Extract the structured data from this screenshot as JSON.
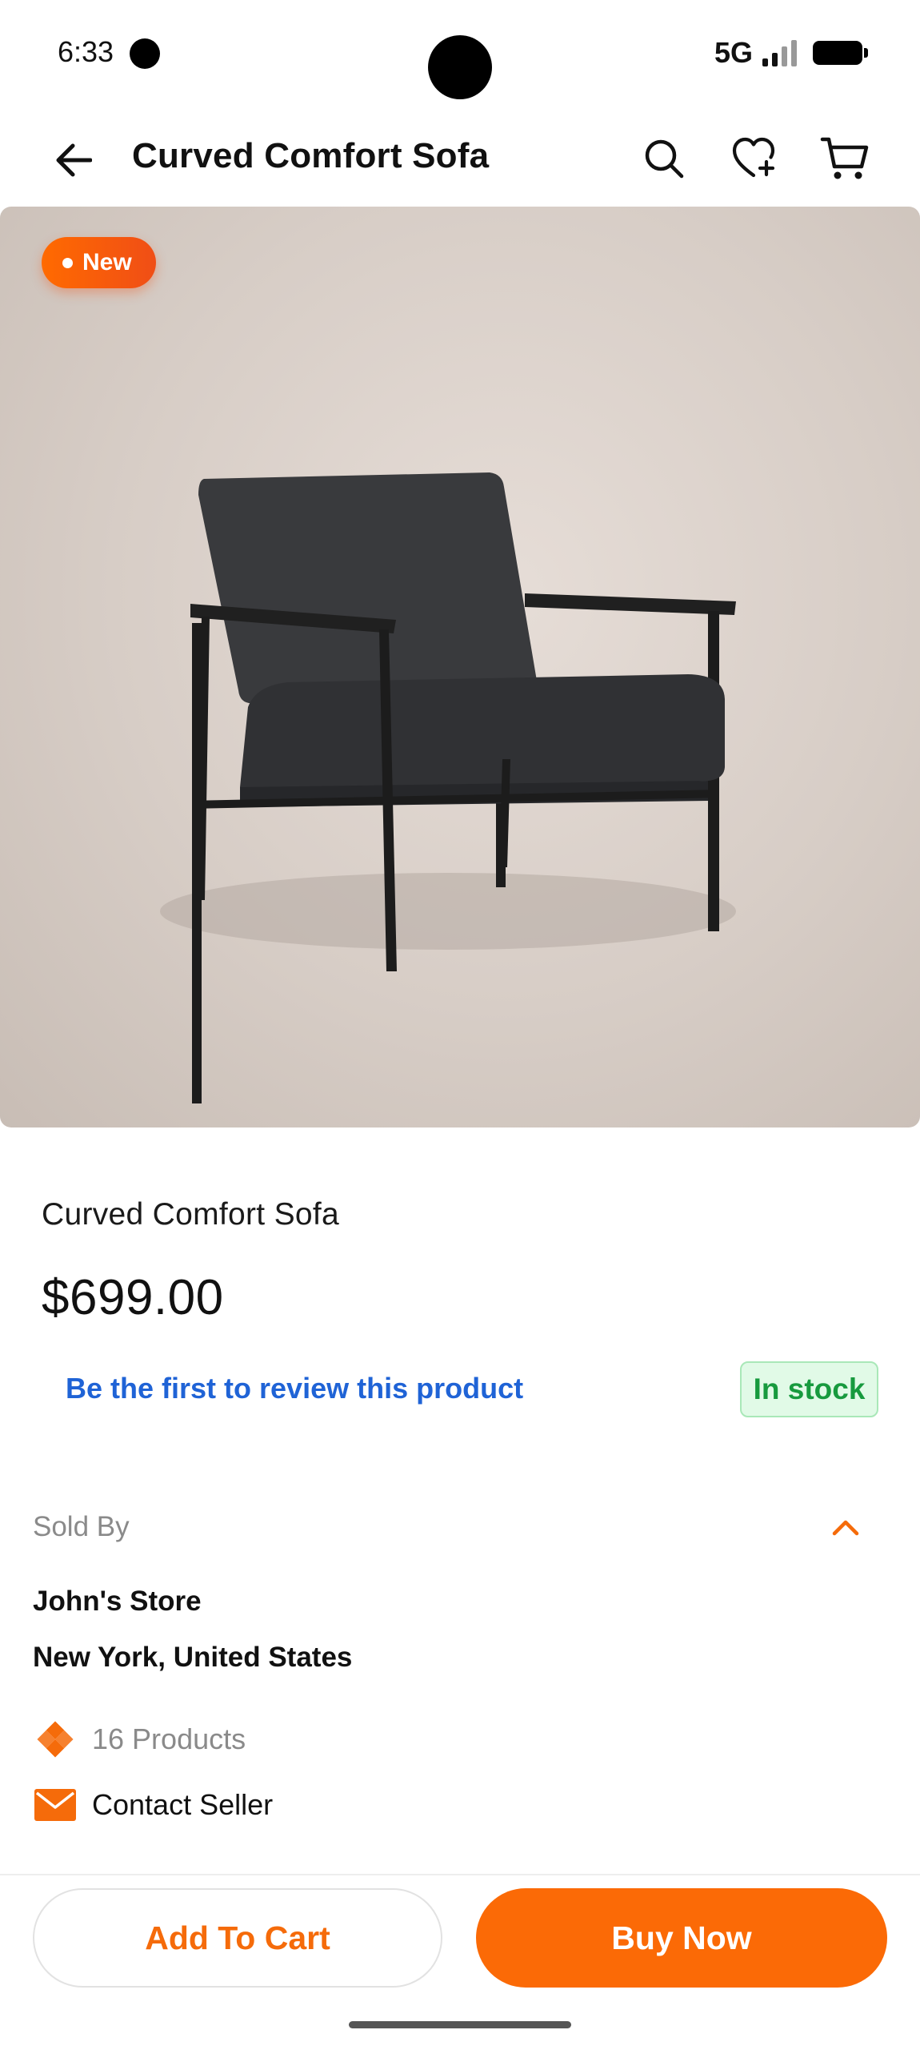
{
  "status_bar": {
    "time": "6:33",
    "network": "5G",
    "signal_level": 0.75,
    "battery_level": 1.0
  },
  "header": {
    "title": "Curved Comfort Sofa",
    "icons": [
      "back-arrow-icon",
      "search-icon",
      "wishlist-heart-plus-icon",
      "cart-icon"
    ]
  },
  "product": {
    "badge": "New",
    "name": "Curved Comfort Sofa",
    "price": "$699.00",
    "review_link": "Be the first to review this product",
    "stock_status": "In stock"
  },
  "seller": {
    "section_label": "Sold By",
    "store_name": "John's Store",
    "location": "New York, United States",
    "products_count": "16 Products",
    "contact_label": "Contact Seller"
  },
  "actions": {
    "add_to_cart": "Add To Cart",
    "buy_now": "Buy Now"
  },
  "colors": {
    "accent": "#fb6a06",
    "link": "#1f63d6",
    "stock_text": "#179a3e",
    "stock_bg": "#e1fae7"
  }
}
